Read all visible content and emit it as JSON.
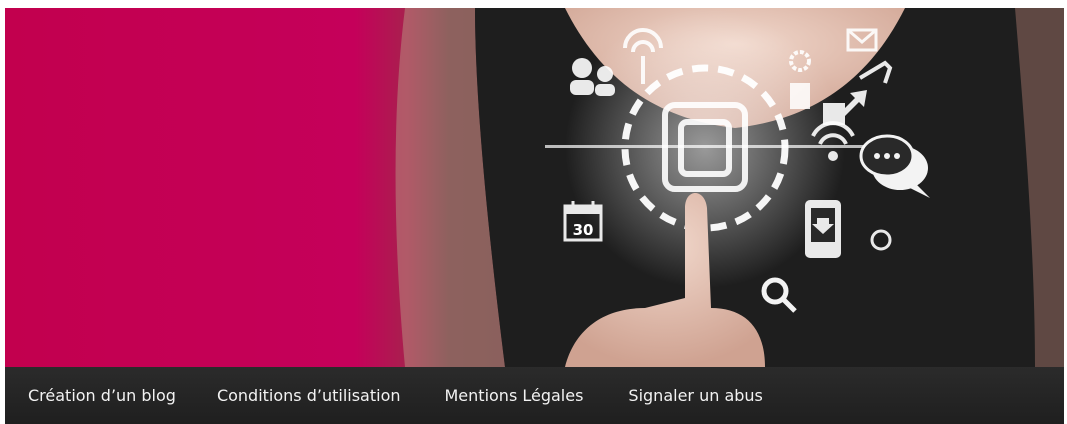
{
  "hero": {
    "calendar_day": "30",
    "icons": [
      "users-icon",
      "antenna-icon",
      "gear-icon",
      "mail-icon",
      "book-icon",
      "expand-arrows-icon",
      "wifi-icon",
      "chat-bubbles-icon",
      "calendar-icon",
      "phone-download-icon",
      "globe-icon",
      "search-icon",
      "blog-logo-icon"
    ],
    "colors": {
      "accent": "#c4004f",
      "navbar": "#222222",
      "nav_text": "#f2f2f2"
    }
  },
  "nav": {
    "items": [
      {
        "label": "Création d’un blog"
      },
      {
        "label": "Conditions d’utilisation"
      },
      {
        "label": "Mentions Légales"
      },
      {
        "label": "Signaler un abus"
      }
    ]
  }
}
